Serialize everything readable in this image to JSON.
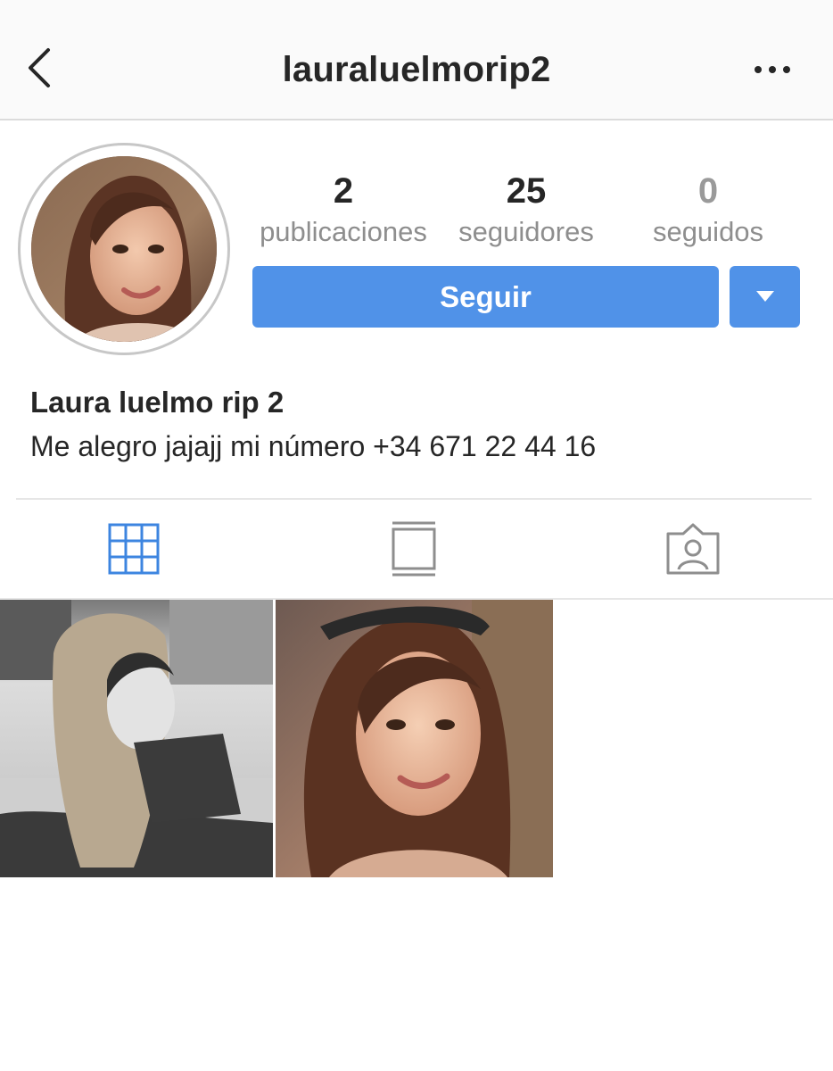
{
  "header": {
    "username": "lauraluelmorip2",
    "back_icon": "chevron-left-icon",
    "more_icon": "ellipsis-icon"
  },
  "profile": {
    "stats": {
      "posts": {
        "count": "2",
        "label": "publicaciones"
      },
      "followers": {
        "count": "25",
        "label": "seguidores"
      },
      "following": {
        "count": "0",
        "label": "seguidos"
      }
    },
    "follow_label": "Seguir",
    "display_name": "Laura luelmo rip 2",
    "bio": "Me alegro jajajj mi número +34 671 22 44 16"
  },
  "tabs": [
    {
      "name": "grid",
      "icon": "grid-icon",
      "active": true
    },
    {
      "name": "feed",
      "icon": "feed-icon",
      "active": false
    },
    {
      "name": "tagged",
      "icon": "tagged-person-icon",
      "active": false
    }
  ],
  "colors": {
    "accent": "#5092e8",
    "active_tab": "#3d85e0",
    "inactive_tab": "#8e8e8e"
  },
  "posts_count_visible": 2
}
